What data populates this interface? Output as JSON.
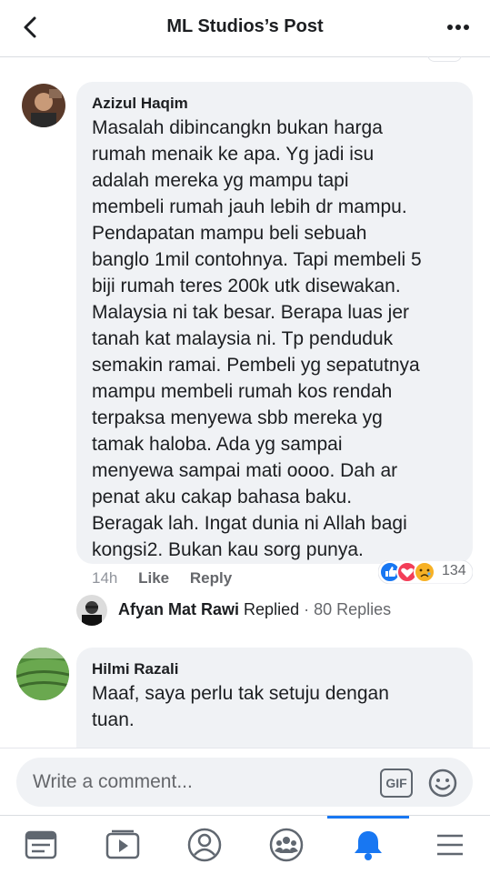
{
  "header": {
    "title": "ML Studios’s Post"
  },
  "comments": [
    {
      "name": "Azizul Haqim",
      "lines": [
        "Masalah dibincangkn bukan harga",
        "rumah menaik ke apa. Yg jadi isu",
        "adalah mereka yg mampu tapi",
        "membeli rumah jauh lebih dr mampu.",
        "Pendapatan mampu beli sebuah",
        "banglo 1mil contohnya. Tapi membeli 5",
        "biji rumah teres 200k utk disewakan.",
        "Malaysia ni tak besar. Berapa luas jer",
        "tanah kat malaysia ni. Tp penduduk",
        "semakin ramai. Pembeli yg sepatutnya",
        "mampu membeli rumah kos rendah",
        "terpaksa menyewa sbb mereka yg",
        "tamak haloba. Ada yg sampai",
        "menyewa sampai mati oooo. Dah ar",
        "penat aku cakap bahasa baku.",
        "Beragak lah. Ingat dunia ni Allah bagi",
        "kongsi2. Bukan kau sorg punya."
      ],
      "time": "14h",
      "like_label": "Like",
      "reply_label": "Reply",
      "reaction_count": "134",
      "reply_summary": {
        "name": "Afyan Mat Rawi",
        "verb": "Replied",
        "count": "· 80 Replies"
      }
    },
    {
      "name": "Hilmi Razali",
      "lines": [
        "Maaf, saya perlu tak setuju dengan",
        "tuan."
      ]
    }
  ],
  "composer": {
    "placeholder": "Write a comment...",
    "gif_label": "GIF"
  },
  "tabs": [
    "news-feed",
    "watch",
    "profile",
    "groups",
    "notifications",
    "menu"
  ],
  "colors": {
    "accent": "#1877f2",
    "love": "#f33e58",
    "haha": "#f7b125"
  }
}
